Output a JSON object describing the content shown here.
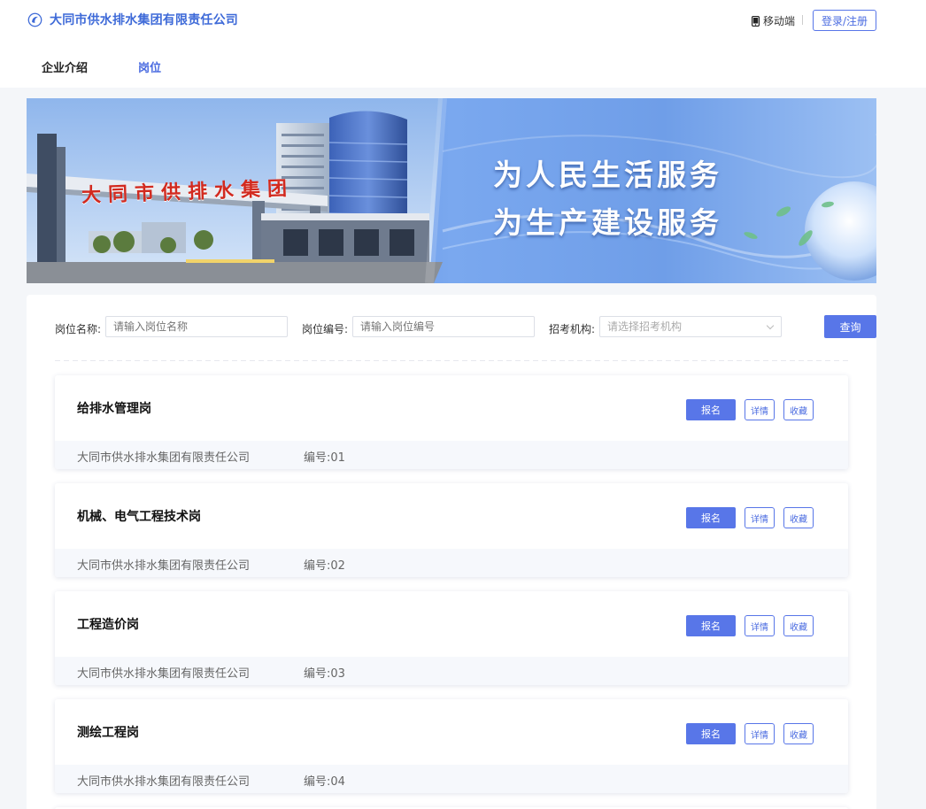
{
  "header": {
    "company_name": "大同市供水排水集团有限责任公司",
    "mobile_label": "移动端",
    "login_label": "登录/注册"
  },
  "nav": {
    "items": [
      {
        "label": "企业介绍"
      },
      {
        "label": "岗位"
      }
    ]
  },
  "banner": {
    "gate_sign": "大同市供排水集团",
    "slogan_line1": "为人民生活服务",
    "slogan_line2": "为生产建设服务"
  },
  "filters": {
    "name_label": "岗位名称:",
    "name_placeholder": "请输入岗位名称",
    "code_label": "岗位编号:",
    "code_placeholder": "请输入岗位编号",
    "org_label": "招考机构:",
    "org_placeholder": "请选择招考机构",
    "query_label": "查询"
  },
  "jobs": [
    {
      "title": "给排水管理岗",
      "company": "大同市供水排水集团有限责任公司",
      "code": "编号:01"
    },
    {
      "title": "机械、电气工程技术岗",
      "company": "大同市供水排水集团有限责任公司",
      "code": "编号:02"
    },
    {
      "title": "工程造价岗",
      "company": "大同市供水排水集团有限责任公司",
      "code": "编号:03"
    },
    {
      "title": "测绘工程岗",
      "company": "大同市供水排水集团有限责任公司",
      "code": "编号:04"
    }
  ],
  "job_actions": {
    "apply": "报名",
    "detail": "详情",
    "favorite": "收藏"
  },
  "colors": {
    "accent": "#5876e8",
    "link": "#4a6be0",
    "title_blue": "#3e6ad8"
  }
}
